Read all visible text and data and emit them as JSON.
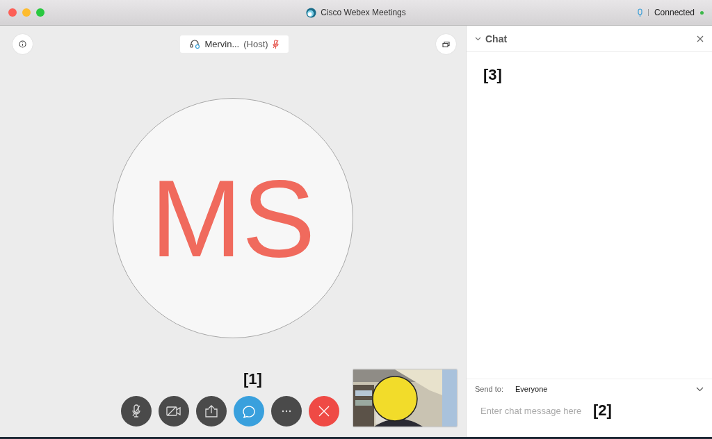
{
  "window": {
    "title": "Cisco Webex Meetings",
    "status": "Connected",
    "connected": true
  },
  "stage": {
    "host": {
      "name": "Mervin...",
      "role": "(Host)",
      "muted": true
    },
    "avatar": {
      "initials": "MS"
    },
    "annotation": "[1]"
  },
  "controls": [
    {
      "kind": "mute",
      "selected": false
    },
    {
      "kind": "video",
      "selected": false
    },
    {
      "kind": "share",
      "selected": false
    },
    {
      "kind": "chat",
      "selected": true
    },
    {
      "kind": "more",
      "selected": false
    },
    {
      "kind": "leave",
      "selected": false
    }
  ],
  "chat": {
    "title": "Chat",
    "body_annotation": "[3]",
    "send_to_label": "Send to:",
    "send_to": "Everyone",
    "placeholder": "Enter chat message here",
    "input_annotation": "[2]"
  }
}
